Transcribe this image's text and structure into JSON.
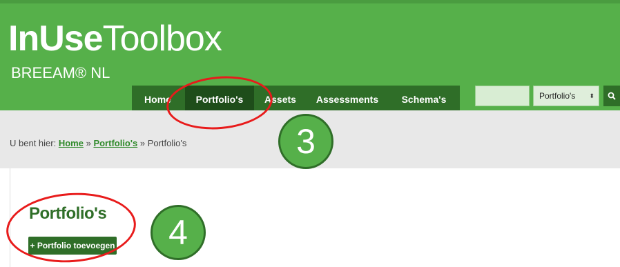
{
  "logo": {
    "bold": "InUse",
    "light": "Toolbox",
    "sub": "BREEAM® NL"
  },
  "nav": {
    "items": [
      {
        "label": "Home"
      },
      {
        "label": "Portfolio's"
      },
      {
        "label": "Assets"
      },
      {
        "label": "Assessments"
      },
      {
        "label": "Schema's"
      }
    ]
  },
  "search": {
    "input_value": "",
    "select_value": "Portfolio's",
    "select_arrows": "⬍",
    "button_icon": "search-icon"
  },
  "breadcrumb": {
    "prefix": "U bent hier:",
    "home": "Home",
    "sep1": "»",
    "portfolios": "Portfolio's",
    "sep2": "»",
    "current": "Portfolio's"
  },
  "page": {
    "title": "Portfolio's",
    "add_button": "+ Portfolio toevoegen"
  },
  "annotations": {
    "badge3": "3",
    "badge4": "4"
  },
  "colors": {
    "header_green": "#56b04a",
    "nav_dark": "#2f6e28",
    "nav_active": "#1e4d1a",
    "callout_red": "#e81b1b"
  }
}
